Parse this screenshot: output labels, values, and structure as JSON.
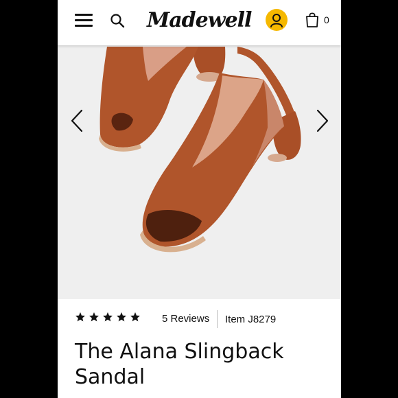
{
  "header": {
    "menu_icon": "hamburger-icon",
    "search_icon": "search-icon",
    "logo_text": "Madewell",
    "account_icon": "user-icon",
    "account_color": "#f5b800",
    "bag_icon": "shopping-bag-icon",
    "bag_count": "0"
  },
  "gallery": {
    "prev_icon": "chevron-left-icon",
    "next_icon": "chevron-right-icon",
    "background": "#efefef",
    "product_color": "#b0552b"
  },
  "product": {
    "rating_stars": 5,
    "reviews_label": "5 Reviews",
    "item_label": "Item J8279",
    "title": "The Alana Slingback Sandal"
  }
}
